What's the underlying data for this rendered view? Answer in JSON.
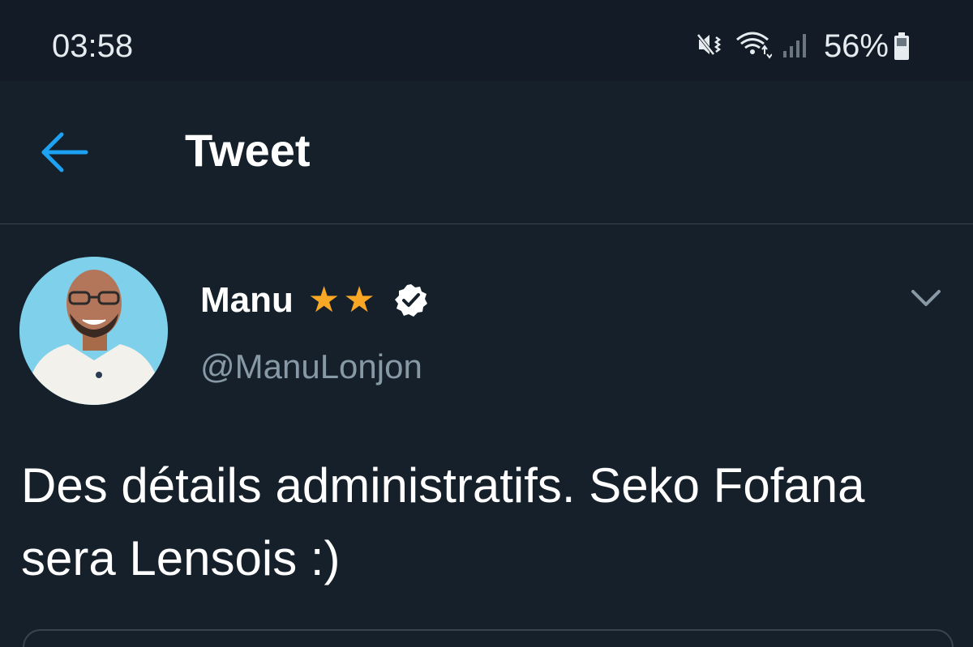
{
  "status_bar": {
    "time": "03:58",
    "battery_percent": "56%",
    "icons": [
      "mute-vibrate-icon",
      "wifi-icon",
      "signal-icon",
      "battery-icon"
    ]
  },
  "header": {
    "title": "Tweet",
    "back_icon": "back-arrow-icon"
  },
  "tweet": {
    "author_name": "Manu",
    "author_stars": [
      "★",
      "★"
    ],
    "author_handle": "@ManuLonjon",
    "verified_icon": "verified-badge-icon",
    "more_icon": "chevron-down-icon",
    "text": "Des détails administratifs. Seko Fofana sera Lensois :)"
  },
  "colors": {
    "background": "#15202b",
    "status_bar": "#131c26",
    "accent": "#1da1f2",
    "star": "#f9a826",
    "secondary_text": "#8899a6",
    "divider": "#38444d"
  }
}
